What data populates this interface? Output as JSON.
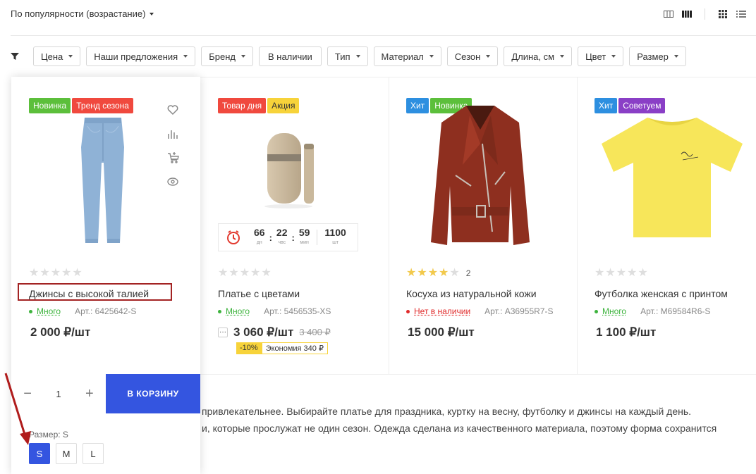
{
  "sort": {
    "label": "По популярности (возрастание)"
  },
  "filters": [
    "Цена",
    "Наши предложения",
    "Бренд",
    "В наличии",
    "Тип",
    "Материал",
    "Сезон",
    "Длина, см",
    "Цвет",
    "Размер"
  ],
  "filters_without_caret": [
    3
  ],
  "colors": {
    "accent": "#3455e0",
    "green": "#3db33d",
    "red": "#e02a2a",
    "yellow": "#f7d33a"
  },
  "products": [
    {
      "badges": [
        {
          "text": "Новинка",
          "color": "#5cbf3b"
        },
        {
          "text": "Тренд сезона",
          "color": "#f0493e"
        }
      ],
      "rating": 0,
      "reviews": "",
      "name": "Джинсы с высокой талией",
      "stock": "Много",
      "stock_status": "in",
      "art": "Арт.: 6425642-S",
      "price": "2 000 ₽/шт"
    },
    {
      "badges": [
        {
          "text": "Товар дня",
          "color": "#f0493e"
        },
        {
          "text": "Акция",
          "color": "#f7d33a",
          "dark": true
        }
      ],
      "rating": 0,
      "reviews": "",
      "name": "Платье с цветами",
      "stock": "Много",
      "stock_status": "in",
      "art": "Арт.: 5456535-XS",
      "price": "3 060 ₽/шт",
      "old_price": "3 400 ₽",
      "discount": "-10%",
      "economy": "Экономия 340 ₽",
      "timer": {
        "days": "66",
        "days_u": "дн",
        "hours": "22",
        "hours_u": "чвс",
        "mins": "59",
        "mins_u": "мин",
        "count": "1100",
        "count_u": "шт"
      }
    },
    {
      "badges": [
        {
          "text": "Хит",
          "color": "#2d8fe0"
        },
        {
          "text": "Новинка",
          "color": "#5cbf3b"
        }
      ],
      "rating": 4,
      "reviews": "2",
      "name": "Косуха из натуральной кожи",
      "stock": "Нет в наличии",
      "stock_status": "out",
      "art": "Арт.: A36955R7-S",
      "price": "15 000 ₽/шт"
    },
    {
      "badges": [
        {
          "text": "Хит",
          "color": "#2d8fe0"
        },
        {
          "text": "Советуем",
          "color": "#8a3fc6"
        }
      ],
      "rating": 0,
      "reviews": "",
      "name": "Футболка женская с принтом",
      "stock": "Много",
      "stock_status": "in",
      "art": "Арт.: M69584R6-S",
      "price": "1 100 ₽/шт"
    }
  ],
  "active_card": {
    "qty": "1",
    "add_to_cart": "В КОРЗИНУ",
    "size_label": "Размер: S",
    "sizes": [
      "S",
      "M",
      "L"
    ],
    "selected_size": "S"
  },
  "description": [
    "привлекательнее. Выбирайте платье для праздника, куртку на весну, футболку и джинсы на каждый день.",
    "и, которые прослужат не один сезон. Одежда сделана из качественного материала, поэтому форма сохранится"
  ]
}
